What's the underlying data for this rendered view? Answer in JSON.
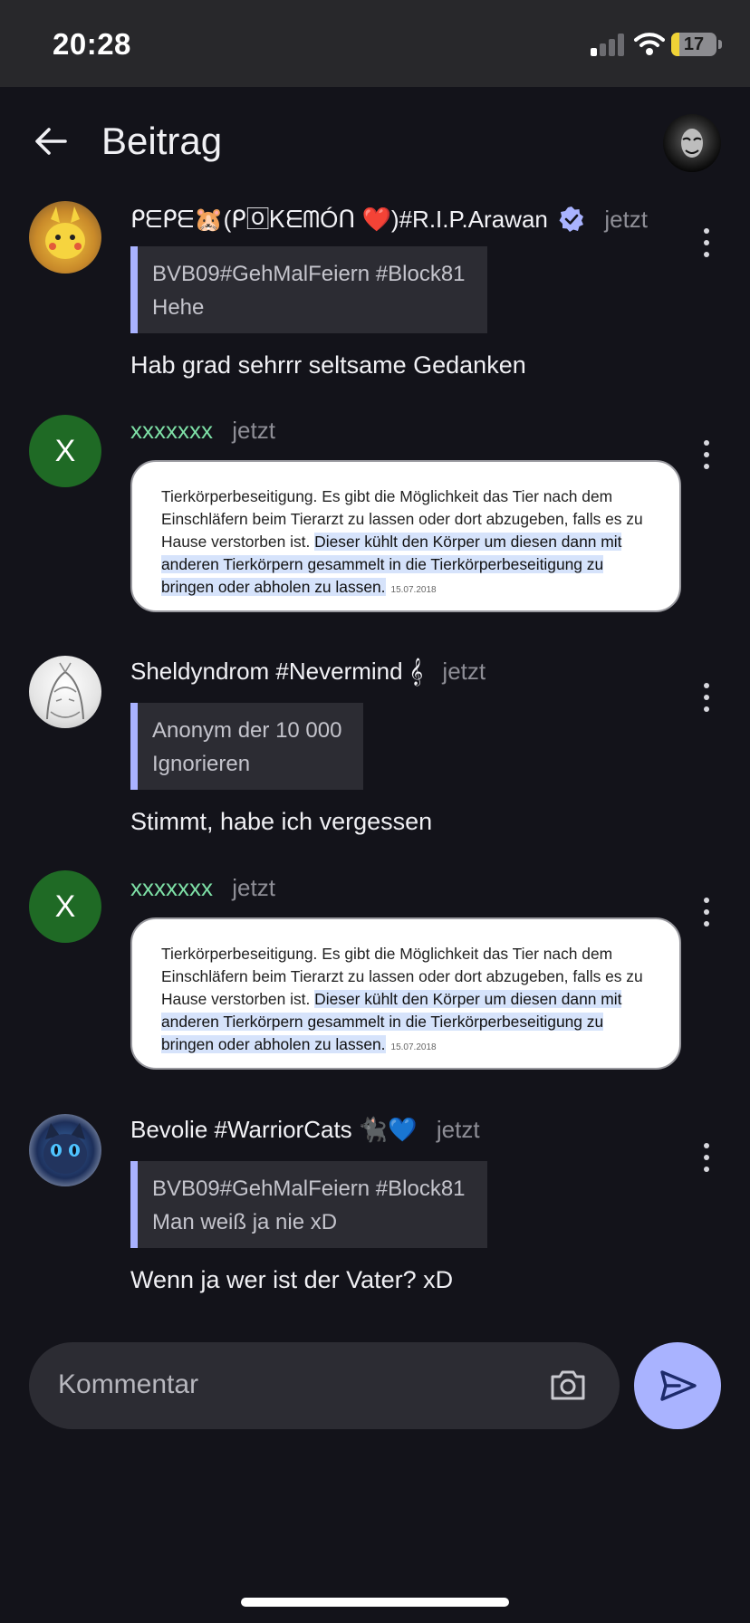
{
  "status_bar": {
    "time": "20:28",
    "battery": "17",
    "battery_level": 0.17
  },
  "app_bar": {
    "title": "Beitrag"
  },
  "comments": [
    {
      "author": "ᑭᗴᑭᗴ🐹(ᑭ🄾ᏦᗴᗰÓᑎ ❤️)#R.I.P.Arawan",
      "time": "jetzt",
      "quote": {
        "author": "BVB09#GehMalFeiern #Block81",
        "text": "Hehe"
      },
      "text": "Hab grad sehrrr seltsame Gedanken"
    },
    {
      "author": "xxxxxxx",
      "avatar_letter": "X",
      "time": "jetzt",
      "image_text": {
        "plain": [
          "Tierkörperbeseitigung. Es gibt die Möglichkeit das Tier nach dem",
          "Einschläfern beim Tierarzt zu lassen oder dort abzugeben, falls es zu",
          "Hause verstorben ist. "
        ],
        "highlight": [
          "Dieser kühlt den Körper um diesen dann mit",
          "anderen Tierkörpern gesammelt in die Tierkörperbeseitigung zu",
          "bringen oder abholen zu lassen."
        ],
        "date": "15.07.2018"
      }
    },
    {
      "author": "Sheldyndrom #Nevermind 𝄞",
      "time": "jetzt",
      "quote": {
        "author": "Anonym der 10 000",
        "text": "Ignorieren"
      },
      "text": "Stimmt, habe ich vergessen"
    },
    {
      "author": "xxxxxxx",
      "avatar_letter": "X",
      "time": "jetzt",
      "image_text": {
        "plain": [
          "Tierkörperbeseitigung. Es gibt die Möglichkeit das Tier nach dem",
          "Einschläfern beim Tierarzt zu lassen oder dort abzugeben, falls es zu",
          "Hause verstorben ist. "
        ],
        "highlight": [
          "Dieser kühlt den Körper um diesen dann mit",
          "anderen Tierkörpern gesammelt in die Tierkörperbeseitigung zu",
          "bringen oder abholen zu lassen."
        ],
        "date": "15.07.2018"
      }
    },
    {
      "author": "Bevolie #WarriorCats 🐈‍⬛💙",
      "time": "jetzt",
      "quote": {
        "author": "BVB09#GehMalFeiern #Block81",
        "text": "Man weiß ja nie xD"
      },
      "text": "Wenn ja wer ist der Vater? xD"
    }
  ],
  "composer": {
    "placeholder": "Kommentar"
  },
  "colors": {
    "accent": "#a9b3ff",
    "background": "#13131a",
    "surface": "#2c2c33",
    "username_green": "#7ee0a6",
    "avatar_green": "#1f6a25"
  },
  "icons": {
    "back": "arrow-left-icon",
    "more": "more-vertical-icon",
    "verified": "verified-badge-icon",
    "camera": "camera-icon",
    "send": "send-icon"
  }
}
